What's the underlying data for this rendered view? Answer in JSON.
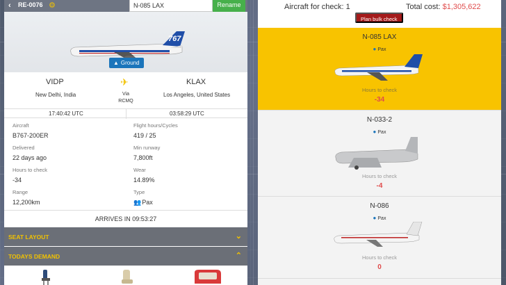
{
  "left": {
    "route_code": "RE-0076",
    "name_input_value": "N-085 LAX",
    "rename_label": "Rename",
    "status_badge": "Ground",
    "origin": {
      "code": "VIDP",
      "city": "New Delhi, India"
    },
    "destination": {
      "code": "KLAX",
      "city": "Los Angeles, United States"
    },
    "via_label": "Via",
    "via_code": "RCMQ",
    "departure_time": "17:40:42 UTC",
    "arrival_time": "03:58:29 UTC",
    "specs": {
      "aircraft_label": "Aircraft",
      "aircraft_value": "B767-200ER",
      "flight_hours_label": "Flight hours/Cycles",
      "flight_hours_value": "419 / 25",
      "delivered_label": "Delivered",
      "delivered_value": "22 days ago",
      "min_runway_label": "Min runway",
      "min_runway_value": "7,800ft",
      "hours_check_label": "Hours to check",
      "hours_check_value": "-34",
      "wear_label": "Wear",
      "wear_value": "14.89%",
      "range_label": "Range",
      "range_value": "12,200km",
      "type_label": "Type",
      "type_value": "Pax"
    },
    "arrives_text": "ARRIVES IN 09:53:27",
    "seat_layout_label": "SEAT LAYOUT",
    "todays_demand_label": "TODAYS DEMAND",
    "hero_livery_text": "767"
  },
  "right": {
    "check_count_label": "Aircraft for check: 1",
    "total_cost_label": "Total cost: ",
    "total_cost_value": "$1,305,622",
    "bulk_button_label": "Plan bulk check",
    "aircraft": [
      {
        "name": "N-085 LAX",
        "type": "Pax",
        "hours_label": "Hours to check",
        "hours_value": "-34",
        "highlight": true
      },
      {
        "name": "N-033-2",
        "type": "Pax",
        "hours_label": "Hours to check",
        "hours_value": "-4",
        "highlight": false
      },
      {
        "name": "N-086",
        "type": "Pax",
        "hours_label": "Hours to check",
        "hours_value": "0",
        "highlight": false
      }
    ]
  },
  "colors": {
    "accent_yellow": "#f8c300",
    "rename_green": "#47b04b",
    "badge_blue": "#1b75bb",
    "danger_red": "#e04b4b",
    "bulk_red": "#a41a1a",
    "accordion_gray": "#6b6f77"
  },
  "icons": [
    "back-chevron-icon",
    "gear-icon",
    "ground-icon",
    "plane-icon",
    "pax-group-icon",
    "chevron-down-icon",
    "chevron-up-icon",
    "person-icon"
  ]
}
